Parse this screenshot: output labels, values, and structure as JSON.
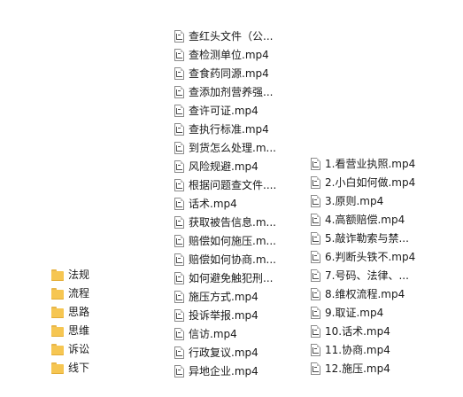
{
  "folders": [
    {
      "name": "法规",
      "icon": "folder-icon"
    },
    {
      "name": "流程",
      "icon": "folder-icon"
    },
    {
      "name": "思路",
      "icon": "folder-icon"
    },
    {
      "name": "思维",
      "icon": "folder-icon"
    },
    {
      "name": "诉讼",
      "icon": "folder-icon"
    },
    {
      "name": "线下",
      "icon": "folder-icon"
    }
  ],
  "middle_files": [
    {
      "name": "查红头文件（公..."
    },
    {
      "name": "查检测单位.mp4"
    },
    {
      "name": "查食药同源.mp4"
    },
    {
      "name": "查添加剂营养强..."
    },
    {
      "name": "查许可证.mp4"
    },
    {
      "name": "查执行标准.mp4"
    },
    {
      "name": "到货怎么处理.m..."
    },
    {
      "name": "风险规避.mp4"
    },
    {
      "name": "根据问题查文件...."
    },
    {
      "name": "话术.mp4"
    },
    {
      "name": "获取被告信息.m..."
    },
    {
      "name": "赔偿如何施压.m..."
    },
    {
      "name": "赔偿如何协商.m..."
    },
    {
      "name": "如何避免触犯刑..."
    },
    {
      "name": "施压方式.mp4"
    },
    {
      "name": "投诉举报.mp4"
    },
    {
      "name": "信访.mp4"
    },
    {
      "name": "行政复议.mp4"
    },
    {
      "name": "异地企业.mp4"
    }
  ],
  "right_files": [
    {
      "name": "1.看营业执照.mp4"
    },
    {
      "name": "2.小白如何做.mp4"
    },
    {
      "name": "3.原则.mp4"
    },
    {
      "name": "4.高额赔偿.mp4"
    },
    {
      "name": "5.敲诈勒索与禁..."
    },
    {
      "name": "6.判断头铁不.mp4"
    },
    {
      "name": "7.号码、法律、..."
    },
    {
      "name": "8.维权流程.mp4"
    },
    {
      "name": "9.取证.mp4"
    },
    {
      "name": "10.话术.mp4"
    },
    {
      "name": "11.协商.mp4"
    },
    {
      "name": "12.施压.mp4"
    }
  ]
}
